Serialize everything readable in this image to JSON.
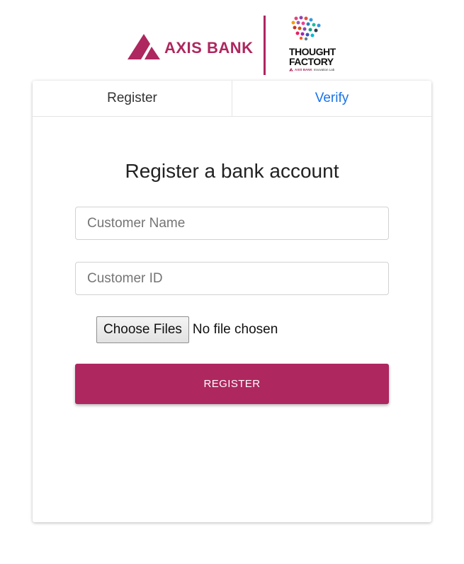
{
  "brand": {
    "axis_bank_name": "AXIS BANK",
    "thought_factory_line1": "THOUGHT",
    "thought_factory_line2": "FACTORY",
    "thought_factory_bank": "AXIS BANK",
    "thought_factory_tagline": "Innovation Lab",
    "colors": {
      "axis_maroon": "#ae275f",
      "tab_link_blue": "#1a73e8"
    }
  },
  "tabs": [
    {
      "label": "Register",
      "active": true
    },
    {
      "label": "Verify",
      "active": false
    }
  ],
  "form": {
    "title": "Register a bank account",
    "customer_name": {
      "placeholder": "Customer Name",
      "value": ""
    },
    "customer_id": {
      "placeholder": "Customer ID",
      "value": ""
    },
    "file_button_label": "Choose Files",
    "file_status": "No file chosen",
    "submit_label": "REGISTER"
  }
}
